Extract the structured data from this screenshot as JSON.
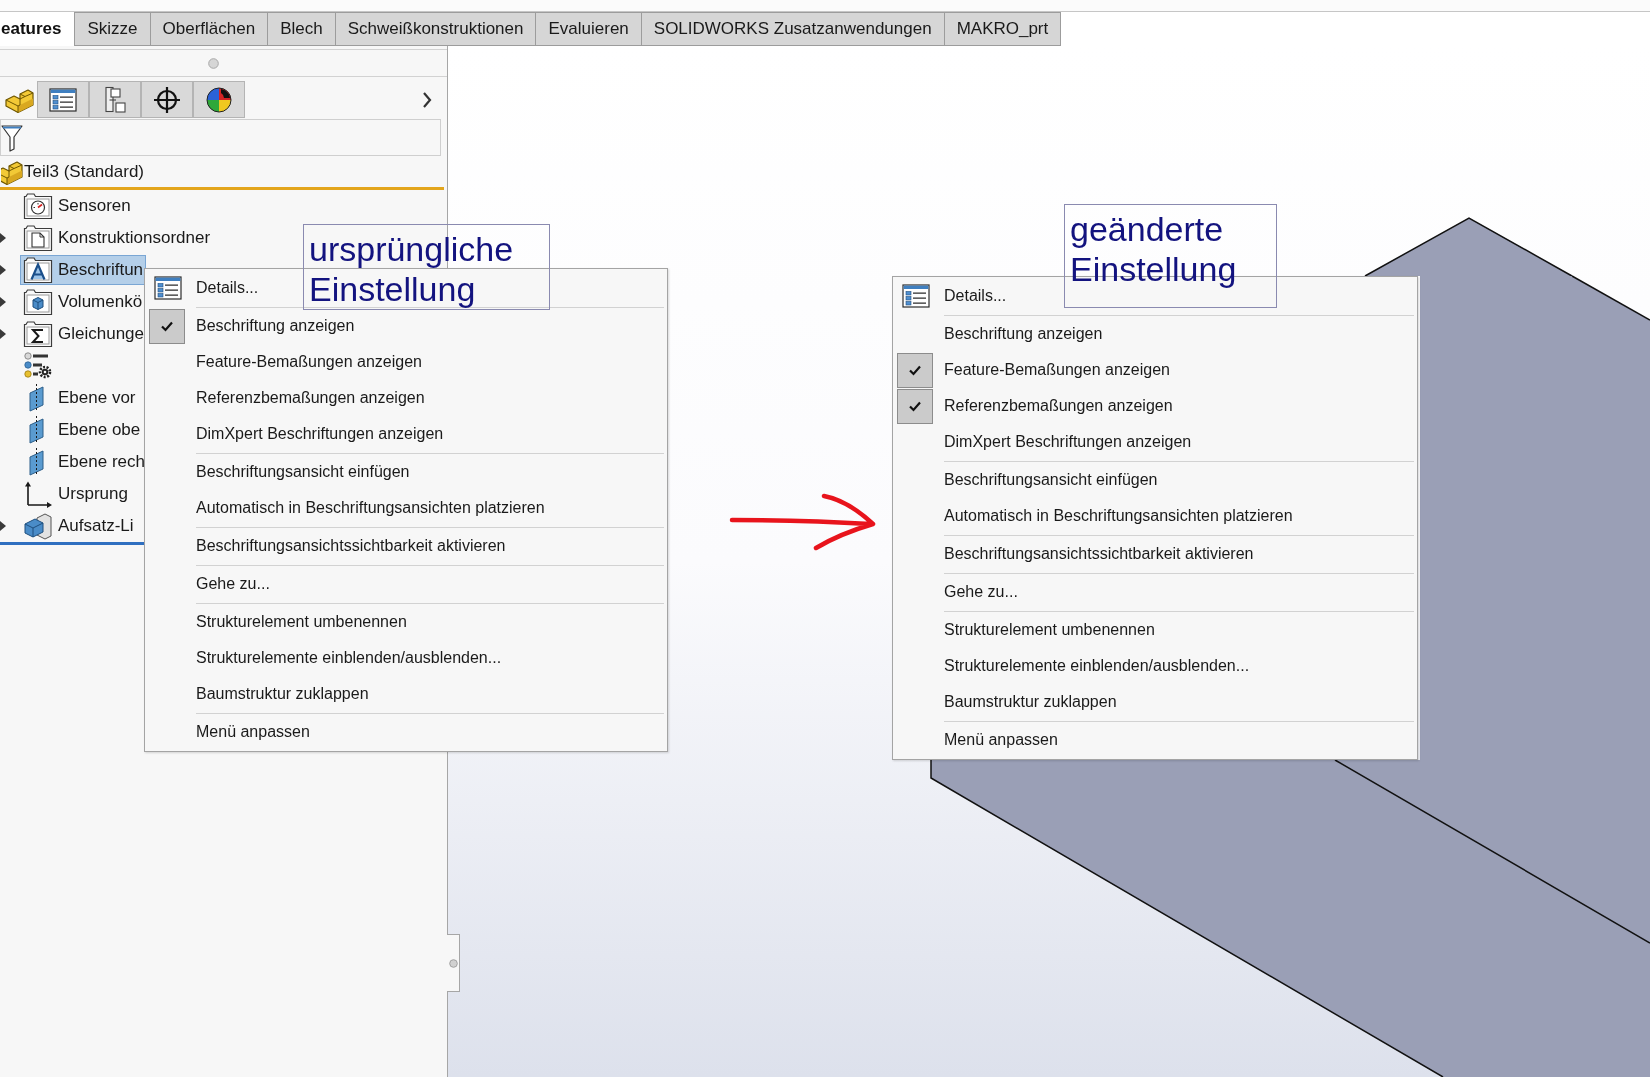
{
  "toolbar_tabs": [
    {
      "label": "eatures",
      "selected": true
    },
    {
      "label": "Skizze",
      "selected": false
    },
    {
      "label": "Oberflächen",
      "selected": false
    },
    {
      "label": "Blech",
      "selected": false
    },
    {
      "label": "Schweißkonstruktionen",
      "selected": false
    },
    {
      "label": "Evaluieren",
      "selected": false
    },
    {
      "label": "SOLIDWORKS Zusatzanwendungen",
      "selected": false
    },
    {
      "label": "MAKRO_prt",
      "selected": false
    }
  ],
  "panel": {
    "tabs": [
      {
        "kind": "part",
        "selected": true
      },
      {
        "kind": "list",
        "selected": false
      },
      {
        "kind": "tree",
        "selected": false
      },
      {
        "kind": "target",
        "selected": false
      },
      {
        "kind": "sphere",
        "selected": false
      }
    ],
    "tree": {
      "label": "Teil3 (Standard)",
      "kind": "part",
      "selected": false,
      "children": [
        {
          "label": "Sensoren",
          "kind": "sensor",
          "expandable": false,
          "selected": false
        },
        {
          "label": "Konstruktionsordner",
          "kind": "folder",
          "expandable": true,
          "selected": false
        },
        {
          "label": "Beschriftun",
          "kind": "annotation",
          "expandable": true,
          "selected": true
        },
        {
          "label": "Volumenkö",
          "kind": "solid",
          "expandable": true,
          "selected": false
        },
        {
          "label": "Gleichunge",
          "kind": "equation",
          "expandable": true,
          "selected": false
        },
        {
          "kind": "material",
          "expandable": false,
          "selected": false
        },
        {
          "label": "Ebene vor",
          "kind": "plane",
          "expandable": false,
          "selected": false
        },
        {
          "label": "Ebene obe",
          "kind": "plane",
          "expandable": false,
          "selected": false
        },
        {
          "label": "Ebene rech",
          "kind": "plane",
          "expandable": false,
          "selected": false
        },
        {
          "label": "Ursprung",
          "kind": "origin",
          "expandable": false,
          "selected": false
        },
        {
          "label": "Aufsatz-Li",
          "kind": "extrude",
          "expandable": true,
          "selected": false
        }
      ]
    }
  },
  "menus": [
    {
      "groups": [
        [
          {
            "label": "Details...",
            "kind": "icon",
            "checked": false
          }
        ],
        [
          {
            "label": "Beschriftung anzeigen",
            "kind": "text",
            "checked": true
          },
          {
            "label": "Feature-Bemaßungen anzeigen",
            "kind": "text",
            "checked": false
          },
          {
            "label": "Referenzbemaßungen anzeigen",
            "kind": "text",
            "checked": false
          },
          {
            "label": "DimXpert Beschriftungen anzeigen",
            "kind": "text",
            "checked": false
          }
        ],
        [
          {
            "label": "Beschriftungsansicht einfügen",
            "kind": "text",
            "checked": false
          },
          {
            "label": "Automatisch in Beschriftungsansichten platzieren",
            "kind": "text",
            "checked": false
          }
        ],
        [
          {
            "label": "Beschriftungsansichtssichtbarkeit aktivieren",
            "kind": "text",
            "checked": false
          }
        ],
        [
          {
            "label": "Gehe zu...",
            "kind": "text",
            "checked": false
          }
        ],
        [
          {
            "label": "Strukturelement umbenennen",
            "kind": "text",
            "checked": false
          },
          {
            "label": "Strukturelemente einblenden/ausblenden...",
            "kind": "text",
            "checked": false
          },
          {
            "label": "Baumstruktur zuklappen",
            "kind": "text",
            "checked": false
          }
        ],
        [
          {
            "label": "Menü anpassen",
            "kind": "text",
            "checked": false
          }
        ]
      ]
    },
    {
      "groups": [
        [
          {
            "label": "Details...",
            "kind": "icon",
            "checked": false
          }
        ],
        [
          {
            "label": "Beschriftung anzeigen",
            "kind": "text",
            "checked": false
          },
          {
            "label": "Feature-Bemaßungen anzeigen",
            "kind": "text",
            "checked": true
          },
          {
            "label": "Referenzbemaßungen anzeigen",
            "kind": "text",
            "checked": true
          },
          {
            "label": "DimXpert Beschriftungen anzeigen",
            "kind": "text",
            "checked": false
          }
        ],
        [
          {
            "label": "Beschriftungsansicht einfügen",
            "kind": "text",
            "checked": false
          },
          {
            "label": "Automatisch in Beschriftungsansichten platzieren",
            "kind": "text",
            "checked": false
          }
        ],
        [
          {
            "label": "Beschriftungsansichtssichtbarkeit aktivieren",
            "kind": "text",
            "checked": false
          }
        ],
        [
          {
            "label": "Gehe zu...",
            "kind": "text",
            "checked": false
          }
        ],
        [
          {
            "label": "Strukturelement umbenennen",
            "kind": "text",
            "checked": false
          },
          {
            "label": "Strukturelemente einblenden/ausblenden...",
            "kind": "text",
            "checked": false
          },
          {
            "label": "Baumstruktur zuklappen",
            "kind": "text",
            "checked": false
          }
        ],
        [
          {
            "label": "Menü anpassen",
            "kind": "text",
            "checked": false
          }
        ]
      ]
    }
  ],
  "notes": [
    {
      "text": "ursprüngliche Einstellung"
    },
    {
      "text": "geänderte Einstellung"
    }
  ]
}
